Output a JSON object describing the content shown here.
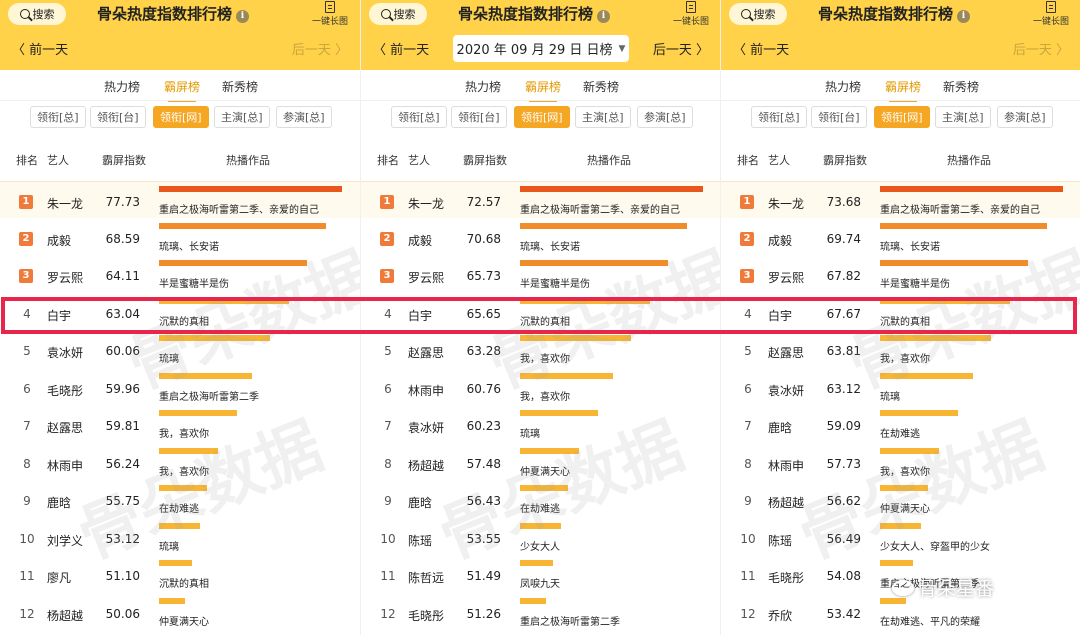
{
  "colors": {
    "header_bg": "#ffd24a",
    "accent": "#f5a623",
    "bar_red": "#e8581c",
    "bar_orange": "#f08d2a",
    "bar_yellow": "#f7b533",
    "highlight_border": "#e8254a",
    "badge": "#f07a3a"
  },
  "common": {
    "search_label": "搜索",
    "app_title": "骨朵热度指数排行榜",
    "info_glyph": "i",
    "long_image_label": "一键长图",
    "prev_day": "〈 前一天",
    "next_day": "后一天 〉",
    "tabs": [
      "热力榜",
      "霸屏榜",
      "新秀榜"
    ],
    "active_tab": "霸屏榜",
    "filters": [
      "领衔[总]",
      "领衔[台]",
      "领衔[网]",
      "主演[总]",
      "参演[总]"
    ],
    "active_filter": "领衔[网]",
    "columns": [
      "排名",
      "艺人",
      "霸屏指数",
      "热播作品"
    ],
    "watermark_text": "骨朵数据",
    "wechat_account": "骨朵星番"
  },
  "panels": [
    {
      "date_label": "",
      "rows": [
        {
          "rank": "1",
          "artist": "朱一龙",
          "score": "77.73",
          "works": "重启之极海听雷第二季、亲爱的自己",
          "bar": 0.99
        },
        {
          "rank": "2",
          "artist": "成毅",
          "score": "68.59",
          "works": "琉璃、长安诺",
          "bar": 0.9
        },
        {
          "rank": "3",
          "artist": "罗云熙",
          "score": "64.11",
          "works": "半是蜜糖半是伤",
          "bar": 0.8
        },
        {
          "rank": "4",
          "artist": "白宇",
          "score": "63.04",
          "works": "沉默的真相",
          "bar": 0.7
        },
        {
          "rank": "5",
          "artist": "袁冰妍",
          "score": "60.06",
          "works": "琉璃",
          "bar": 0.6
        },
        {
          "rank": "6",
          "artist": "毛晓彤",
          "score": "59.96",
          "works": "重启之极海听雷第二季",
          "bar": 0.5
        },
        {
          "rank": "7",
          "artist": "赵露思",
          "score": "59.81",
          "works": "我，喜欢你",
          "bar": 0.42
        },
        {
          "rank": "8",
          "artist": "林雨申",
          "score": "56.24",
          "works": "我，喜欢你",
          "bar": 0.32
        },
        {
          "rank": "9",
          "artist": "鹿晗",
          "score": "55.75",
          "works": "在劫难逃",
          "bar": 0.26
        },
        {
          "rank": "10",
          "artist": "刘学义",
          "score": "53.12",
          "works": "琉璃",
          "bar": 0.22
        },
        {
          "rank": "11",
          "artist": "廖凡",
          "score": "51.10",
          "works": "沉默的真相",
          "bar": 0.18
        },
        {
          "rank": "12",
          "artist": "杨超越",
          "score": "50.06",
          "works": "仲夏满天心",
          "bar": 0.14
        }
      ]
    },
    {
      "date_label": "2020 年 09 月 29 日   日榜",
      "rows": [
        {
          "rank": "1",
          "artist": "朱一龙",
          "score": "72.57",
          "works": "重启之极海听雷第二季、亲爱的自己",
          "bar": 0.99
        },
        {
          "rank": "2",
          "artist": "成毅",
          "score": "70.68",
          "works": "琉璃、长安诺",
          "bar": 0.9
        },
        {
          "rank": "3",
          "artist": "罗云熙",
          "score": "65.73",
          "works": "半是蜜糖半是伤",
          "bar": 0.8
        },
        {
          "rank": "4",
          "artist": "白宇",
          "score": "65.65",
          "works": "沉默的真相",
          "bar": 0.7
        },
        {
          "rank": "5",
          "artist": "赵露思",
          "score": "63.28",
          "works": "我，喜欢你",
          "bar": 0.6
        },
        {
          "rank": "6",
          "artist": "林雨申",
          "score": "60.76",
          "works": "我，喜欢你",
          "bar": 0.5
        },
        {
          "rank": "7",
          "artist": "袁冰妍",
          "score": "60.23",
          "works": "琉璃",
          "bar": 0.42
        },
        {
          "rank": "8",
          "artist": "杨超越",
          "score": "57.48",
          "works": "仲夏满天心",
          "bar": 0.32
        },
        {
          "rank": "9",
          "artist": "鹿晗",
          "score": "56.43",
          "works": "在劫难逃",
          "bar": 0.26
        },
        {
          "rank": "10",
          "artist": "陈瑶",
          "score": "53.55",
          "works": "少女大人",
          "bar": 0.22
        },
        {
          "rank": "11",
          "artist": "陈哲远",
          "score": "51.49",
          "works": "凤唳九天",
          "bar": 0.18
        },
        {
          "rank": "12",
          "artist": "毛晓彤",
          "score": "51.26",
          "works": "重启之极海听雷第二季",
          "bar": 0.14
        }
      ]
    },
    {
      "date_label": "",
      "rows": [
        {
          "rank": "1",
          "artist": "朱一龙",
          "score": "73.68",
          "works": "重启之极海听雷第二季、亲爱的自己",
          "bar": 0.99
        },
        {
          "rank": "2",
          "artist": "成毅",
          "score": "69.74",
          "works": "琉璃、长安诺",
          "bar": 0.9
        },
        {
          "rank": "3",
          "artist": "罗云熙",
          "score": "67.82",
          "works": "半是蜜糖半是伤",
          "bar": 0.8
        },
        {
          "rank": "4",
          "artist": "白宇",
          "score": "67.67",
          "works": "沉默的真相",
          "bar": 0.7
        },
        {
          "rank": "5",
          "artist": "赵露思",
          "score": "63.81",
          "works": "我，喜欢你",
          "bar": 0.6
        },
        {
          "rank": "6",
          "artist": "袁冰妍",
          "score": "63.12",
          "works": "琉璃",
          "bar": 0.5
        },
        {
          "rank": "7",
          "artist": "鹿晗",
          "score": "59.09",
          "works": "在劫难逃",
          "bar": 0.42
        },
        {
          "rank": "8",
          "artist": "林雨申",
          "score": "57.73",
          "works": "我，喜欢你",
          "bar": 0.32
        },
        {
          "rank": "9",
          "artist": "杨超越",
          "score": "56.62",
          "works": "仲夏满天心",
          "bar": 0.26
        },
        {
          "rank": "10",
          "artist": "陈瑶",
          "score": "56.49",
          "works": "少女大人、穿盔甲的少女",
          "bar": 0.22
        },
        {
          "rank": "11",
          "artist": "毛晓彤",
          "score": "54.08",
          "works": "重启之极海听雷第二季",
          "bar": 0.18
        },
        {
          "rank": "12",
          "artist": "乔欣",
          "score": "53.42",
          "works": "在劫难逃、平凡的荣耀",
          "bar": 0.14
        }
      ]
    }
  ]
}
